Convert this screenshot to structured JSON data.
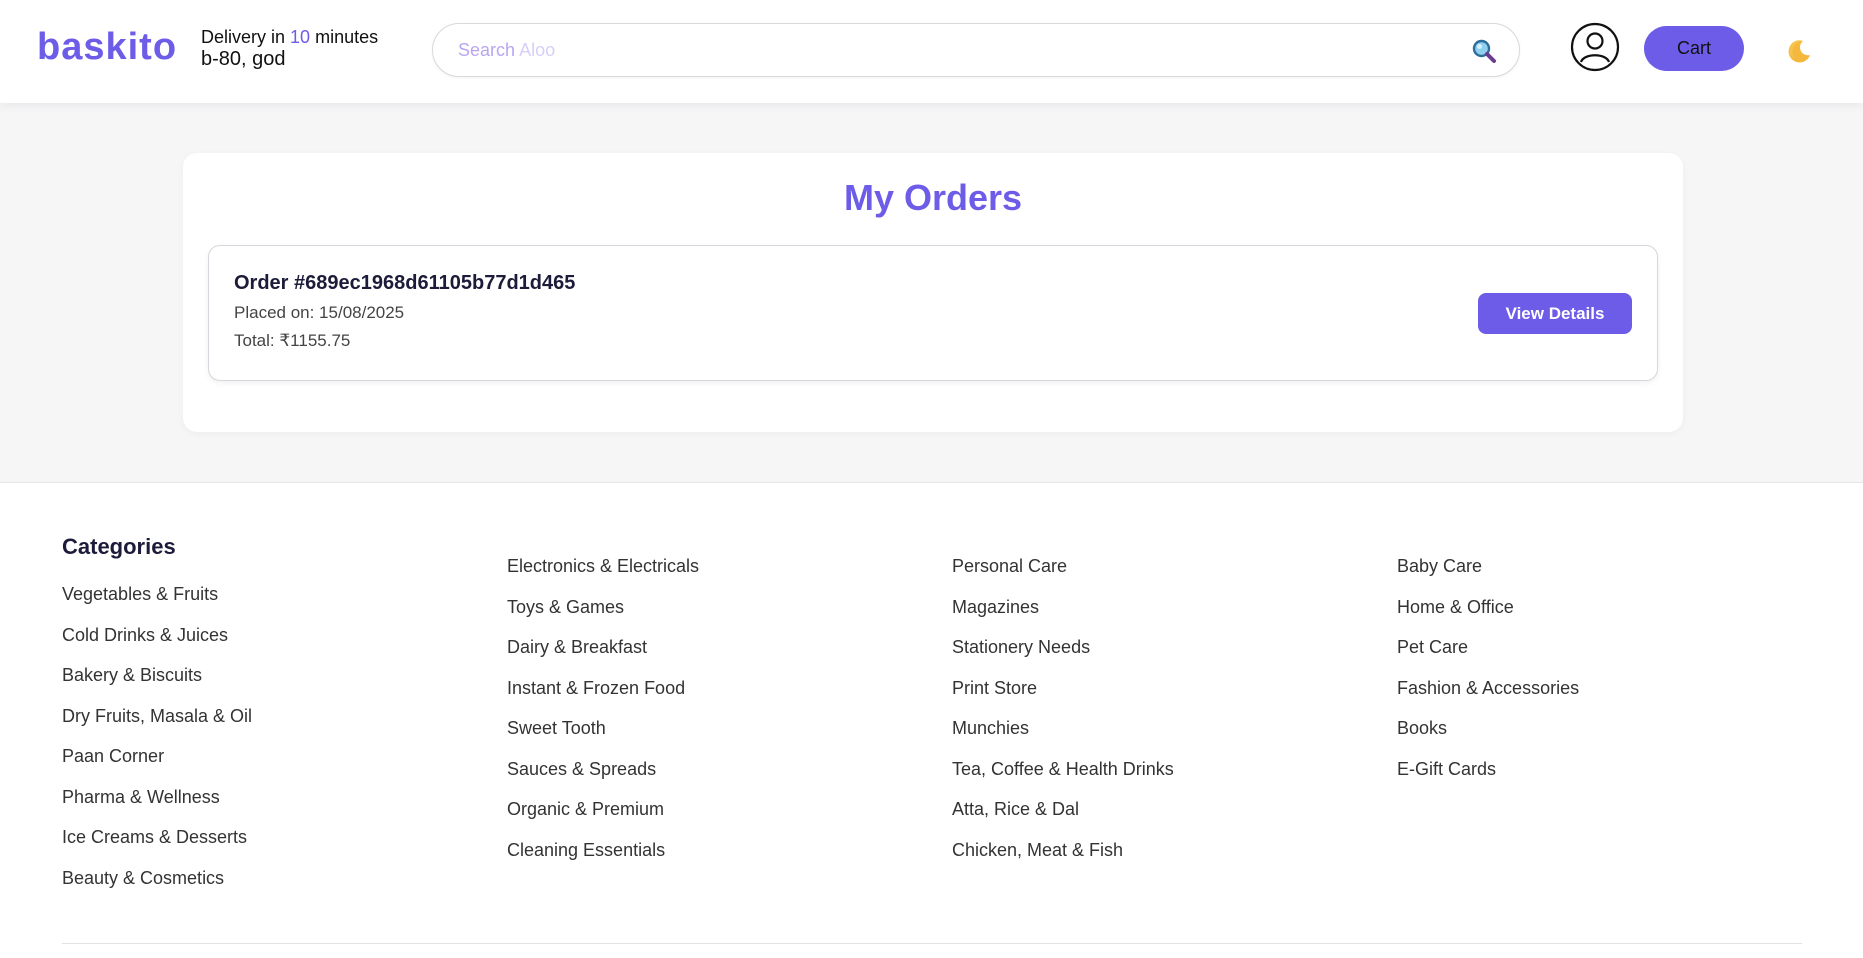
{
  "brand": {
    "name": "baskito",
    "accent_color": "#6c5ce7"
  },
  "delivery": {
    "prefix": "Delivery in",
    "minutes": "10",
    "suffix": "minutes",
    "address": "b-80, god"
  },
  "search": {
    "placeholder_prefix": "Search",
    "placeholder_term": "Aloo",
    "icon": "search-icon"
  },
  "header": {
    "cart_label": "Cart",
    "profile_icon": "user-circle-icon",
    "theme_icon": "moon-icon"
  },
  "orders": {
    "title": "My Orders",
    "items": [
      {
        "id_label": "Order #689ec1968d61105b77d1d465",
        "placed_on": "Placed on: 15/08/2025",
        "total": "Total: ₹1155.75",
        "button_label": "View Details"
      }
    ]
  },
  "footer": {
    "categories_heading": "Categories",
    "columns": [
      [
        "Vegetables & Fruits",
        "Cold Drinks & Juices",
        "Bakery & Biscuits",
        "Dry Fruits, Masala & Oil",
        "Paan Corner",
        "Pharma & Wellness",
        "Ice Creams & Desserts",
        "Beauty & Cosmetics"
      ],
      [
        "Electronics & Electricals",
        "Toys & Games",
        "Dairy & Breakfast",
        "Instant & Frozen Food",
        "Sweet Tooth",
        "Sauces & Spreads",
        "Organic & Premium",
        "Cleaning Essentials"
      ],
      [
        "Personal Care",
        "Magazines",
        "Stationery Needs",
        "Print Store",
        "Munchies",
        "Tea, Coffee & Health Drinks",
        "Atta, Rice & Dal",
        "Chicken, Meat & Fish"
      ],
      [
        "Baby Care",
        "Home & Office",
        "Pet Care",
        "Fashion & Accessories",
        "Books",
        "E-Gift Cards"
      ]
    ]
  }
}
